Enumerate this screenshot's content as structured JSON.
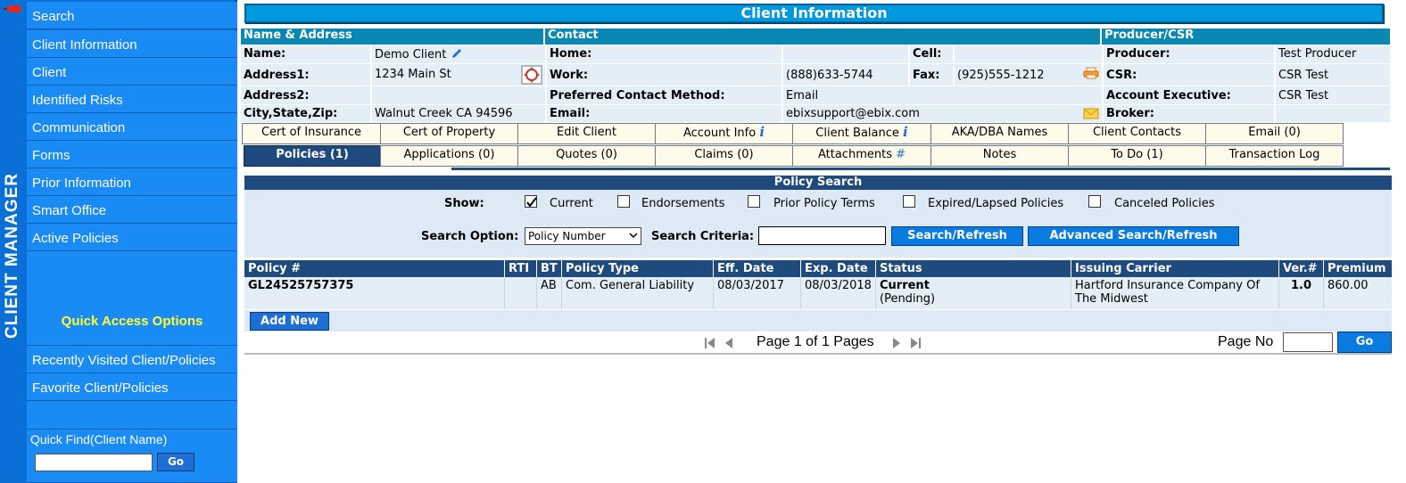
{
  "app": {
    "vertical_title": "CLIENT MANAGER"
  },
  "sidebar": {
    "items": [
      {
        "label": "Search"
      },
      {
        "label": "Client Information"
      },
      {
        "label": "Client"
      },
      {
        "label": "Identified Risks"
      },
      {
        "label": "Communication"
      },
      {
        "label": "Forms"
      },
      {
        "label": "Prior Information"
      },
      {
        "label": "Smart Office"
      },
      {
        "label": "Active Policies"
      }
    ],
    "quick_access_title": "Quick Access Options",
    "recent_label": "Recently Visited Client/Policies",
    "favorite_label": "Favorite Client/Policies",
    "quick_find_label": "Quick Find(Client Name)",
    "quick_find_value": "",
    "go_label": "Go"
  },
  "client_info": {
    "title": "Client Information",
    "sections": {
      "name_address": "Name & Address",
      "contact": "Contact",
      "producer": "Producer/CSR"
    },
    "name_label": "Name:",
    "name_value": "Demo Client",
    "address1_label": "Address1:",
    "address1_value": "1234 Main St",
    "address2_label": "Address2:",
    "address2_value": "",
    "city_label": "City,State,Zip:",
    "city_value": "Walnut Creek CA 94596",
    "home_label": "Home:",
    "home_value": "",
    "work_label": "Work:",
    "work_value": "(888)633-5744",
    "pcm_label": "Preferred Contact Method:",
    "pcm_value": "Email",
    "email_label": "Email:",
    "email_value": "ebixsupport@ebix.com",
    "cell_label": "Cell:",
    "cell_value": "",
    "fax_label": "Fax:",
    "fax_value": "(925)555-1212",
    "producer_label": "Producer:",
    "producer_value": "Test Producer",
    "csr_label": "CSR:",
    "csr_value": "CSR Test",
    "ae_label": "Account Executive:",
    "ae_value": "CSR Test",
    "broker_label": "Broker:",
    "broker_value": ""
  },
  "tabs_row1": [
    "Cert of Insurance",
    "Cert of Property",
    "Edit Client",
    "Account Info",
    "Client Balance",
    "AKA/DBA Names",
    "Client Contacts",
    "Email (0)"
  ],
  "tabs_row2": [
    "Policies (1)",
    "Applications (0)",
    "Quotes (0)",
    "Claims (0)",
    "Attachments",
    "Notes",
    "To Do (1)",
    "Transaction Log"
  ],
  "attach_symbol": "#",
  "info_symbol": "i",
  "policy_search": {
    "title": "Policy Search",
    "show_label": "Show:",
    "filters": [
      {
        "label": "Current",
        "checked": true
      },
      {
        "label": "Endorsements",
        "checked": false
      },
      {
        "label": "Prior Policy Terms",
        "checked": false
      },
      {
        "label": "Expired/Lapsed Policies",
        "checked": false
      },
      {
        "label": "Canceled Policies",
        "checked": false
      }
    ],
    "option_label": "Search Option:",
    "option_value": "Policy Number",
    "criteria_label": "Search Criteria:",
    "criteria_value": "",
    "search_button": "Search/Refresh",
    "advanced_button": "Advanced Search/Refresh"
  },
  "results": {
    "headers": [
      "Policy #",
      "RTI",
      "BT",
      "Policy Type",
      "Eff. Date",
      "Exp. Date",
      "Status",
      "Issuing Carrier",
      "Ver.#",
      "Premium"
    ],
    "rows": [
      {
        "policy": "GL24525757375",
        "rti": "",
        "bt": "AB",
        "type": "Com. General Liability",
        "eff": "08/03/2017",
        "exp": "08/03/2018",
        "status": "Current",
        "status_sub": "(Pending)",
        "carrier_line1": "Hartford Insurance Company Of",
        "carrier_line2": "The Midwest",
        "ver": "1.0",
        "premium": "860.00"
      }
    ],
    "add_new": "Add New"
  },
  "pager": {
    "text": "Page 1 of 1 Pages",
    "page_no_label": "Page No",
    "page_no_value": "",
    "go_label": "Go"
  }
}
